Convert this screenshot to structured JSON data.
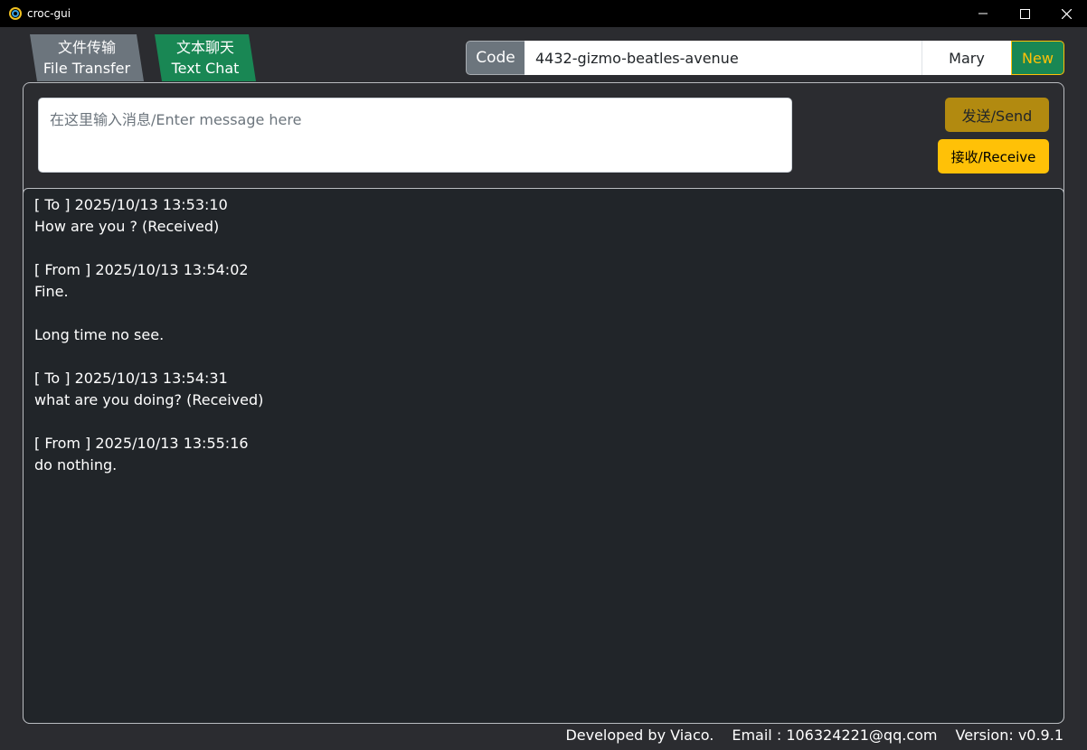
{
  "window": {
    "title": "croc-gui"
  },
  "tabs": [
    {
      "label_cn": "文件传输",
      "label_en": "File Transfer",
      "active": false,
      "color": "#6c757d"
    },
    {
      "label_cn": "文本聊天",
      "label_en": "Text Chat",
      "active": true,
      "color": "#198754"
    }
  ],
  "code_bar": {
    "label": "Code",
    "code_value": "4432-gizmo-beatles-avenue",
    "name_value": "Mary",
    "new_label": "New"
  },
  "compose": {
    "placeholder": "在这里输入消息/Enter message here",
    "send_label": "发送/Send",
    "receive_label": "接收/Receive"
  },
  "chat_log": {
    "lines": [
      "[ To ] 2025/10/13 13:53:10",
      "How are you ? (Received)",
      "",
      "[ From ] 2025/10/13 13:54:02",
      "Fine.",
      "",
      "Long time no see.",
      "",
      "[ To ] 2025/10/13 13:54:31",
      "what are you doing? (Received)",
      "",
      "[ From ] 2025/10/13 13:55:16",
      "do nothing."
    ]
  },
  "footer": {
    "developer": "Developed by Viaco.",
    "email": "Email : 106324221@qq.com",
    "version": "Version: v0.9.1"
  },
  "colors": {
    "accent_yellow": "#ffc107",
    "send_dark_yellow": "#b28a10",
    "green": "#198754",
    "gray": "#6c757d",
    "background": "#2b2c30",
    "log_background": "#212529"
  }
}
